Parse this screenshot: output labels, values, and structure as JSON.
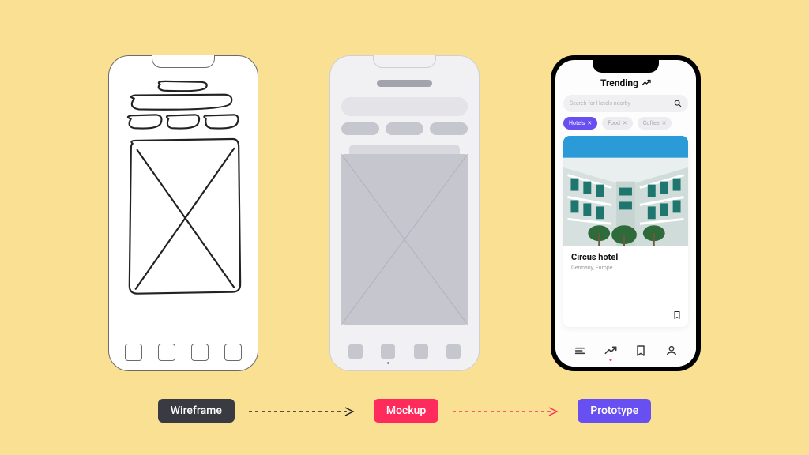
{
  "labels": {
    "wireframe": "Wireframe",
    "mockup": "Mockup",
    "prototype": "Prototype"
  },
  "prototype": {
    "title": "Trending",
    "search_placeholder": "Search for Hotels nearby",
    "chips": {
      "hotels": "Hotels",
      "food": "Food",
      "coffee": "Coffee"
    },
    "card": {
      "title": "Circus hotel",
      "subtitle": "Germany, Europe"
    }
  },
  "colors": {
    "bg": "#fae092",
    "wf_label": "#3a3a42",
    "mk_label": "#ff2b5d",
    "pt_label": "#684ff2"
  }
}
